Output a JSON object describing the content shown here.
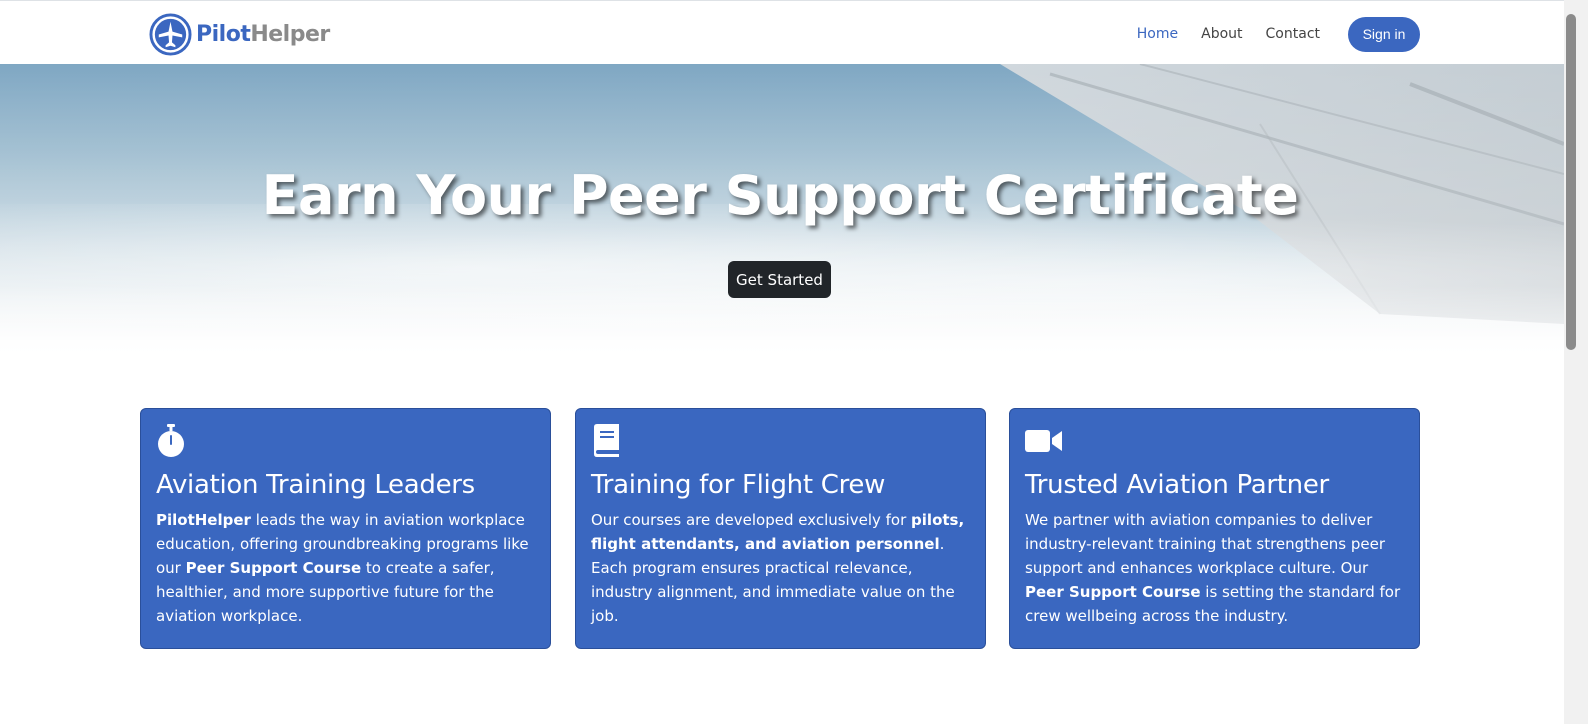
{
  "brand": {
    "name_part1": "Pilot",
    "name_part2": "Helper",
    "logo_icon": "plane-badge-icon"
  },
  "nav": {
    "links": [
      {
        "label": "Home",
        "active": true
      },
      {
        "label": "About",
        "active": false
      },
      {
        "label": "Contact",
        "active": false
      }
    ],
    "signin_label": "Sign in"
  },
  "hero": {
    "title": "Earn Your Peer Support Certificate",
    "cta_label": "Get Started"
  },
  "cards": [
    {
      "icon": "stopwatch-icon",
      "title": "Aviation Training Leaders",
      "text": [
        {
          "bold": true,
          "t": "PilotHelper"
        },
        {
          "bold": false,
          "t": " leads the way in aviation workplace education, offering groundbreaking programs like our "
        },
        {
          "bold": true,
          "t": "Peer Support Course"
        },
        {
          "bold": false,
          "t": " to create a safer, healthier, and more supportive future for the aviation workplace."
        }
      ]
    },
    {
      "icon": "book-icon",
      "title": "Training for Flight Crew",
      "text": [
        {
          "bold": false,
          "t": "Our courses are developed exclusively for "
        },
        {
          "bold": true,
          "t": "pilots, flight attendants, and aviation personnel"
        },
        {
          "bold": false,
          "t": ". Each program ensures practical relevance, industry alignment, and immediate value on the job."
        }
      ]
    },
    {
      "icon": "video-camera-icon",
      "title": "Trusted Aviation Partner",
      "text": [
        {
          "bold": false,
          "t": "We partner with aviation companies to deliver industry-relevant training that strengthens peer support and enhances workplace culture. Our "
        },
        {
          "bold": true,
          "t": "Peer Support Course"
        },
        {
          "bold": false,
          "t": " is setting the standard for crew wellbeing across the industry."
        }
      ]
    }
  ],
  "colors": {
    "primary": "#3b67c0",
    "dark": "#212529",
    "gray_text": "#8a8a8a"
  }
}
